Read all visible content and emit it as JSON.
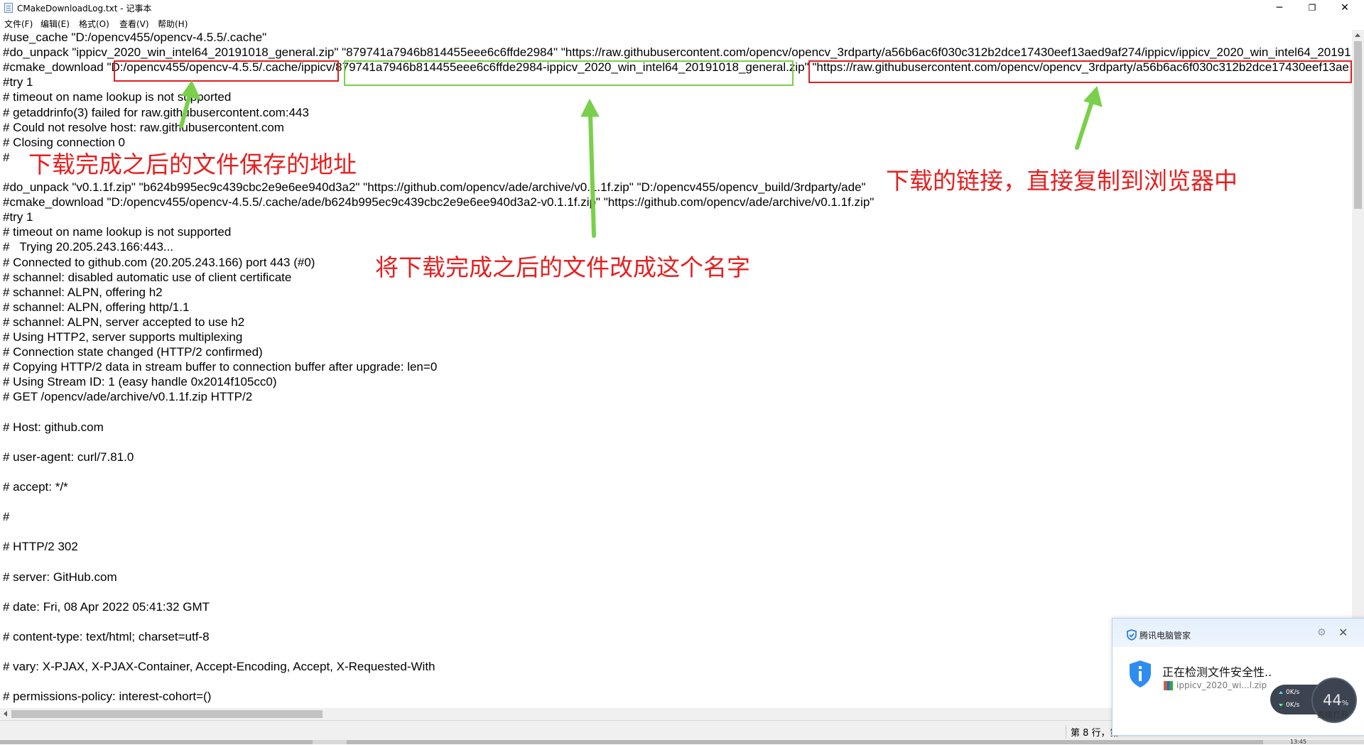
{
  "window": {
    "title": "CMakeDownloadLog.txt - 记事本",
    "minimize": "─",
    "restore": "❐",
    "close": "✕"
  },
  "menu": [
    "文件(F)",
    "编辑(E)",
    "格式(O)",
    "查看(V)",
    "帮助(H)"
  ],
  "lines": [
    "#use_cache \"D:/opencv455/opencv-4.5.5/.cache\"",
    "#do_unpack \"ippicv_2020_win_intel64_20191018_general.zip\" \"879741a7946b814455eee6c6ffde2984\" \"https://raw.githubusercontent.com/opencv/opencv_3rdparty/a56b6ac6f030c312b2dce17430eef13aed9af274/ippicv/ippicv_2020_win_intel64_201910",
    "#cmake_download \"D:/opencv455/opencv-4.5.5/.cache/ippicv/879741a7946b814455eee6c6ffde2984-ippicv_2020_win_intel64_20191018_general.zip\" \"https://raw.githubusercontent.com/opencv/opencv_3rdparty/a56b6ac6f030c312b2dce17430eef13ae",
    "#try 1",
    "# timeout on name lookup is not supported",
    "# getaddrinfo(3) failed for raw.githubusercontent.com:443",
    "# Could not resolve host: raw.githubusercontent.com",
    "# Closing connection 0",
    "#",
    "",
    "#do_unpack \"v0.1.1f.zip\" \"b624b995ec9c439cbc2e9e6ee940d3a2\" \"https://github.com/opencv/ade/archive/v0.1.1f.zip\" \"D:/opencv455/opencv_build/3rdparty/ade\"",
    "#cmake_download \"D:/opencv455/opencv-4.5.5/.cache/ade/b624b995ec9c439cbc2e9e6ee940d3a2-v0.1.1f.zip\" \"https://github.com/opencv/ade/archive/v0.1.1f.zip\"",
    "#try 1",
    "# timeout on name lookup is not supported",
    "#   Trying 20.205.243.166:443...",
    "# Connected to github.com (20.205.243.166) port 443 (#0)",
    "# schannel: disabled automatic use of client certificate",
    "# schannel: ALPN, offering h2",
    "# schannel: ALPN, offering http/1.1",
    "# schannel: ALPN, server accepted to use h2",
    "# Using HTTP2, server supports multiplexing",
    "# Connection state changed (HTTP/2 confirmed)",
    "# Copying HTTP/2 data in stream buffer to connection buffer after upgrade: len=0",
    "# Using Stream ID: 1 (easy handle 0x2014f105cc0)",
    "# GET /opencv/ade/archive/v0.1.1f.zip HTTP/2",
    "",
    "# Host: github.com",
    "",
    "# user-agent: curl/7.81.0",
    "",
    "# accept: */*",
    "",
    "#",
    "",
    "# HTTP/2 302",
    "",
    "# server: GitHub.com",
    "",
    "# date: Fri, 08 Apr 2022 05:41:32 GMT",
    "",
    "# content-type: text/html; charset=utf-8",
    "",
    "# vary: X-PJAX, X-PJAX-Container, Accept-Encoding, Accept, X-Requested-With",
    "",
    "# permissions-policy: interest-cohort=()"
  ],
  "annotations": {
    "save_path": "下载完成之后的文件保存的地址",
    "download_link": "下载的链接，直接复制到浏览器中",
    "rename": "将下载完成之后的文件改成这个名字"
  },
  "status": {
    "position": "第 8 行，第"
  },
  "popup": {
    "brand": "腾讯电脑管家",
    "status": "正在检测文件安全性..",
    "file": "ippicv_2020_wi...l.zip",
    "button": "直接打开",
    "gear": "⚙",
    "close": "✕"
  },
  "netmeter": {
    "up": "0K/s",
    "down": "0K/s",
    "percent": "44",
    "unit": "%"
  },
  "taskbar": {
    "time": "13:45"
  },
  "colors": {
    "annotation_red": "#e52020",
    "annotation_green": "#7ad04a"
  }
}
